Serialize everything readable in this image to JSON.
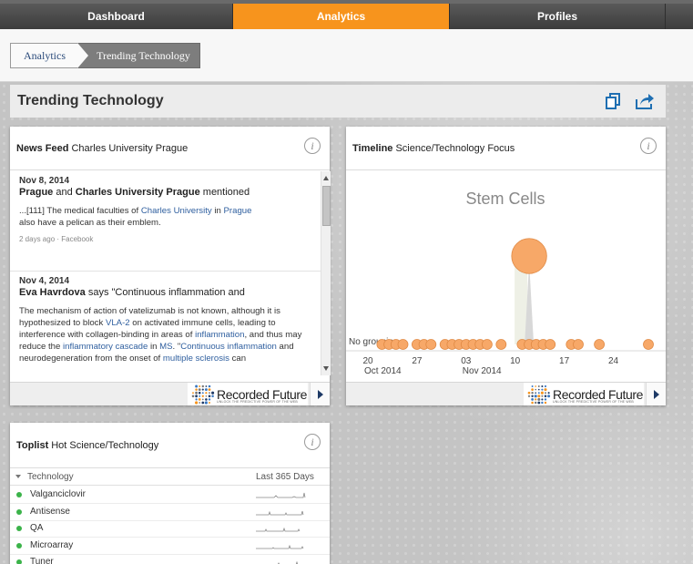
{
  "nav": {
    "tabs": [
      {
        "label": "Dashboard"
      },
      {
        "label": "Analytics",
        "active": true
      },
      {
        "label": "Profiles"
      },
      {
        "label": ""
      }
    ],
    "active_color": "#f7941d"
  },
  "breadcrumb": {
    "items": [
      {
        "label": "Analytics"
      },
      {
        "label": "Trending Technology"
      }
    ]
  },
  "page": {
    "title": "Trending Technology",
    "icons": [
      "copy-icon",
      "share-icon"
    ]
  },
  "news_feed": {
    "title_bold": "News Feed",
    "title_rest": "Charles University Prague",
    "items": [
      {
        "date": "Nov 8, 2014",
        "headline_b1": "Prague",
        "headline_mid": " and ",
        "headline_b2": "Charles University Prague",
        "headline_end": " mentioned",
        "body_1": "...[111] The medical faculties of ",
        "body_link1": "Charles University",
        "body_2": " in ",
        "body_link2": "Prague",
        "body_3": "also have a pelican as their emblem.",
        "meta": "2 days ago · Facebook"
      },
      {
        "date": "Nov 4, 2014",
        "headline_b1": "Eva Havrdova",
        "headline_mid": " says \"Continuous inflammation and",
        "body_1": "The mechanism of action of vatelizumab is not known, although it is hypothesized to block ",
        "body_link1": "VLA-2",
        "body_2": " on activated immune cells, leading to interference with collagen-binding in areas of ",
        "body_link2": "inflammation",
        "body_3": ", and thus may reduce the ",
        "body_link3": "inflammatory cascade",
        "body_4": " in ",
        "body_link4": "MS",
        "body_5": ". \"",
        "body_link5": "Continuous inflammation",
        "body_6": " and neurodegeneration from the onset of ",
        "body_link6": "multiple sclerosis",
        "body_7": " can"
      }
    ]
  },
  "timeline": {
    "title_bold": "Timeline",
    "title_rest": "Science/Technology Focus",
    "chart_title": "Stem Cells",
    "grouping_label": "No grouping"
  },
  "chart_data": {
    "type": "scatter",
    "title": "Stem Cells",
    "x_ticks": [
      {
        "day": "20",
        "month": "Oct 2014"
      },
      {
        "day": "27",
        "month": ""
      },
      {
        "day": "03",
        "month": "Nov 2014"
      },
      {
        "day": "10",
        "month": ""
      },
      {
        "day": "17",
        "month": ""
      },
      {
        "day": "24",
        "month": ""
      }
    ],
    "series": [
      {
        "points": [
          {
            "date": "2014-10-22",
            "size": 1
          },
          {
            "date": "2014-10-23",
            "size": 1
          },
          {
            "date": "2014-10-24",
            "size": 1
          },
          {
            "date": "2014-10-25",
            "size": 1
          },
          {
            "date": "2014-10-27",
            "size": 1
          },
          {
            "date": "2014-10-28",
            "size": 1
          },
          {
            "date": "2014-10-29",
            "size": 1
          },
          {
            "date": "2014-10-31",
            "size": 1
          },
          {
            "date": "2014-11-01",
            "size": 1
          },
          {
            "date": "2014-11-02",
            "size": 1
          },
          {
            "date": "2014-11-03",
            "size": 1
          },
          {
            "date": "2014-11-04",
            "size": 1
          },
          {
            "date": "2014-11-05",
            "size": 1
          },
          {
            "date": "2014-11-06",
            "size": 1
          },
          {
            "date": "2014-11-08",
            "size": 1
          },
          {
            "date": "2014-11-11",
            "size": 1
          },
          {
            "date": "2014-11-12",
            "size": 1
          },
          {
            "date": "2014-11-13",
            "size": 1
          },
          {
            "date": "2014-11-14",
            "size": 1
          },
          {
            "date": "2014-11-15",
            "size": 1
          },
          {
            "date": "2014-11-18",
            "size": 1
          },
          {
            "date": "2014-11-19",
            "size": 1
          },
          {
            "date": "2014-11-22",
            "size": 1
          },
          {
            "date": "2014-11-29",
            "size": 1
          },
          {
            "date": "2014-11-12",
            "size": 3.5,
            "elevated": true
          }
        ]
      }
    ],
    "point_color": "#f7a868",
    "grid": false
  },
  "toplist": {
    "title_bold": "Toplist",
    "title_rest": "Hot Science/Technology",
    "col_technology": "Technology",
    "col_period": "Last 365 Days",
    "rows": [
      {
        "name": "Valganciclovir"
      },
      {
        "name": "Antisense"
      },
      {
        "name": "QA"
      },
      {
        "name": "Microarray"
      },
      {
        "name": "Tuner"
      }
    ]
  },
  "footer": {
    "logo_text": "Recorded Future",
    "logo_tag": "UNLOCK THE PREDICTIVE POWER OF THE WEB"
  }
}
